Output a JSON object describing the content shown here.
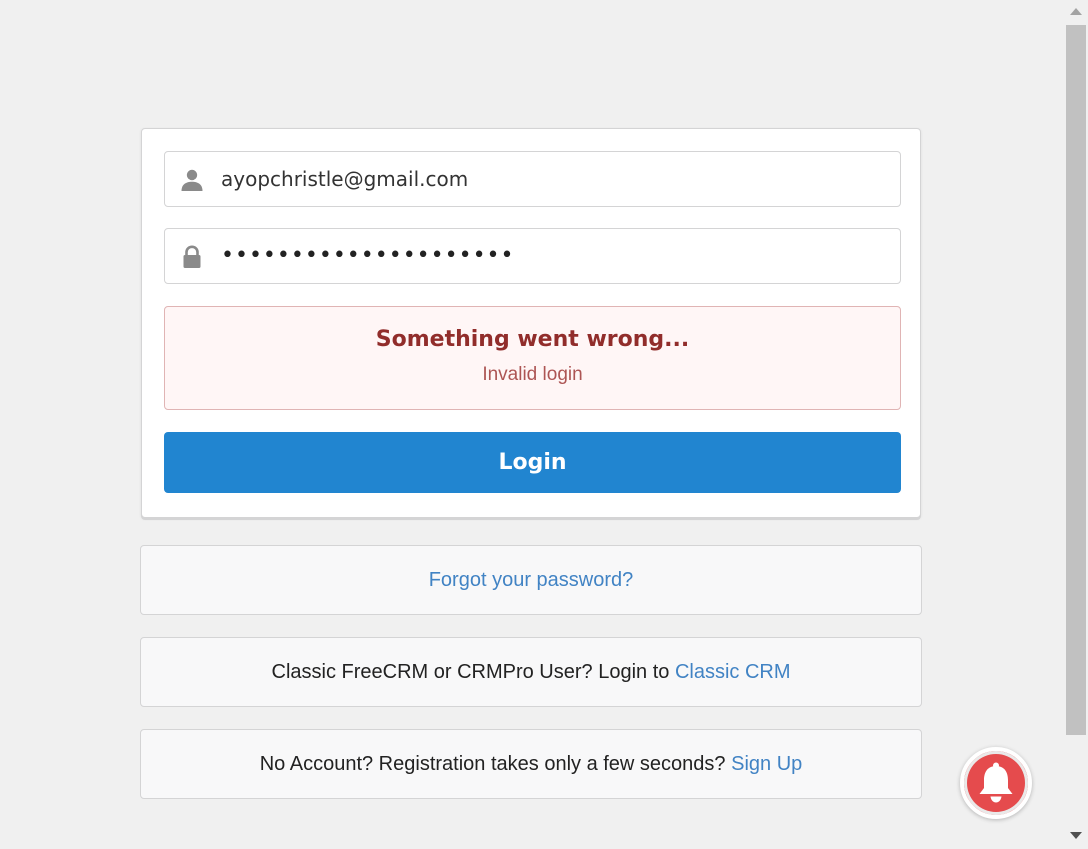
{
  "login_form": {
    "email_value": "ayopchristle@gmail.com",
    "password_mask": "•••••••••••••••••••••",
    "email_icon": "user-icon",
    "password_icon": "lock-icon",
    "error": {
      "header": "Something went wrong...",
      "message": "Invalid login"
    },
    "login_label": "Login"
  },
  "links": {
    "forgot_password": "Forgot your password?",
    "classic_prefix": "Classic FreeCRM or CRMPro User? Login to ",
    "classic_link": "Classic CRM",
    "signup_prefix": "No Account? Registration takes only a few seconds? ",
    "signup_link": "Sign Up"
  },
  "notification": {
    "icon": "bell-icon"
  },
  "colors": {
    "primary": "#2185d0",
    "error_text": "#912d2b",
    "error_bg": "#fff6f6",
    "link": "#4183c4",
    "bell_bg": "#e54b4d"
  }
}
